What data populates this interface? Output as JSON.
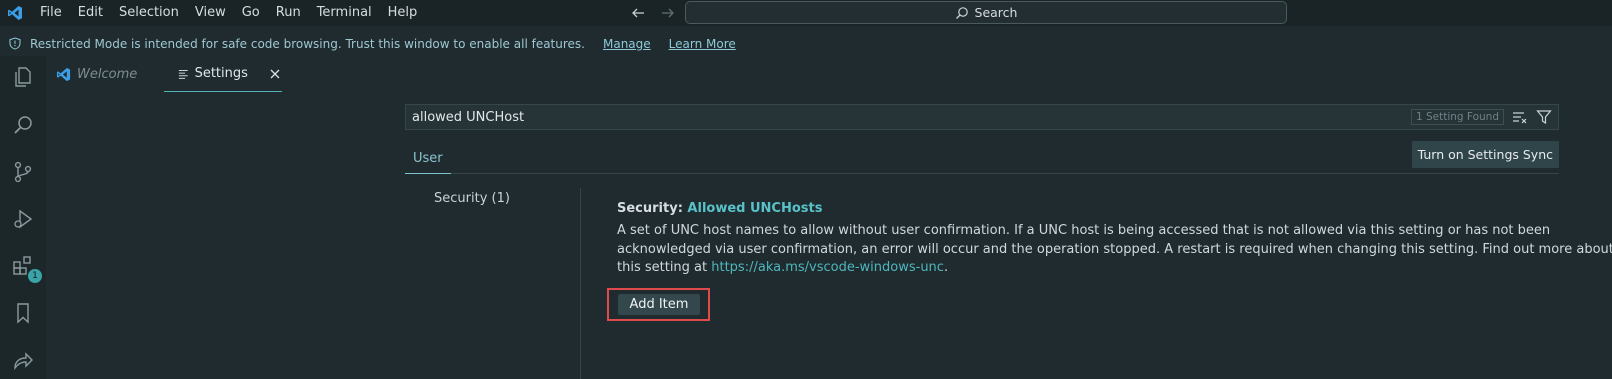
{
  "titlebar": {
    "menu": [
      "File",
      "Edit",
      "Selection",
      "View",
      "Go",
      "Run",
      "Terminal",
      "Help"
    ],
    "search_label": "Search"
  },
  "banner": {
    "text": "Restricted Mode is intended for safe code browsing. Trust this window to enable all features.",
    "manage": "Manage",
    "learn_more": "Learn More"
  },
  "activitybar": {
    "extensions_badge": "1"
  },
  "tabs": {
    "welcome": "Welcome",
    "settings": "Settings"
  },
  "settings": {
    "search_value": "allowed UNCHost",
    "found_count": "1 Setting Found",
    "scope_user": "User",
    "sync_button": "Turn on Settings Sync",
    "toc_item": "Security (1)",
    "category": "Security: ",
    "name": "Allowed UNCHosts",
    "description": "A set of UNC host names to allow without user confirmation. If a UNC host is being accessed that is not allowed via this setting or has not been acknowledged via user confirmation, an error will occur and the operation stopped. A restart is required when changing this setting. Find out more about this setting at ",
    "link": "https://aka.ms/vscode-windows-unc",
    "description_end": ".",
    "add_item": "Add Item"
  },
  "colors": {
    "accent": "#4fb7bd",
    "highlight_box": "#e04a4a"
  }
}
